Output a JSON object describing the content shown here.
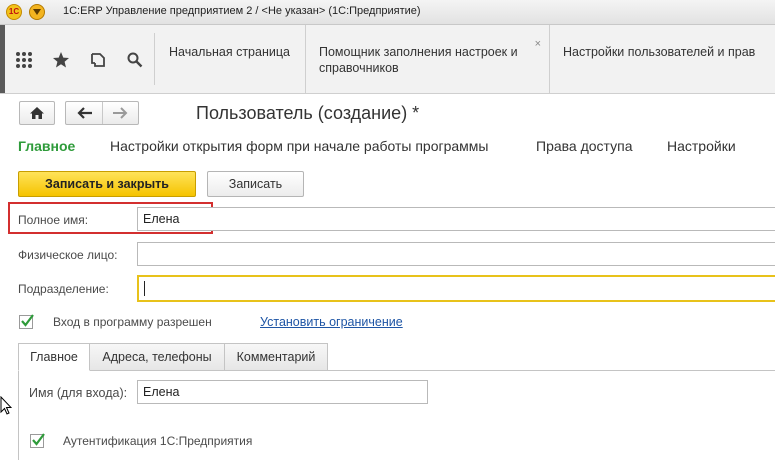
{
  "window": {
    "title": "1С:ERP Управление предприятием 2 / <Не указан>  (1С:Предприятие)"
  },
  "toolbar": {
    "icons": [
      "apps-grid-icon",
      "star-icon",
      "history-icon",
      "search-icon"
    ]
  },
  "tabs": [
    {
      "label": "Начальная страница"
    },
    {
      "label": "Помощник заполнения настроек и справочников",
      "close": "×"
    },
    {
      "label": "Настройки пользователей и прав"
    }
  ],
  "form": {
    "title": "Пользователь (создание) *",
    "sections": [
      {
        "label": "Главное",
        "active": true
      },
      {
        "label": "Настройки открытия форм при начале работы программы"
      },
      {
        "label": "Права доступа"
      },
      {
        "label": "Настройки"
      }
    ],
    "buttons": {
      "save_close": "Записать и закрыть",
      "save": "Записать"
    },
    "fields": {
      "full_name_label": "Полное имя:",
      "full_name_value": "Елена",
      "individual_label": "Физическое лицо:",
      "individual_value": "",
      "department_label": "Подразделение:",
      "department_value": ""
    },
    "login_allowed": {
      "label": "Вход в программу разрешен",
      "checked": true,
      "link": "Установить ограничение"
    },
    "inner_tabs": [
      {
        "label": "Главное",
        "active": true
      },
      {
        "label": "Адреса, телефоны"
      },
      {
        "label": "Комментарий"
      }
    ],
    "login_name_label": "Имя (для входа):",
    "login_name_value": "Елена",
    "auth_1c": {
      "label": "Аутентификация 1С:Предприятия",
      "checked": true
    }
  },
  "colors": {
    "accent_green": "#2e9b3a",
    "primary_button": "#f5c300",
    "highlight_border": "#d32f2f",
    "link": "#1e55a5",
    "focus_border": "#e8c21a"
  }
}
